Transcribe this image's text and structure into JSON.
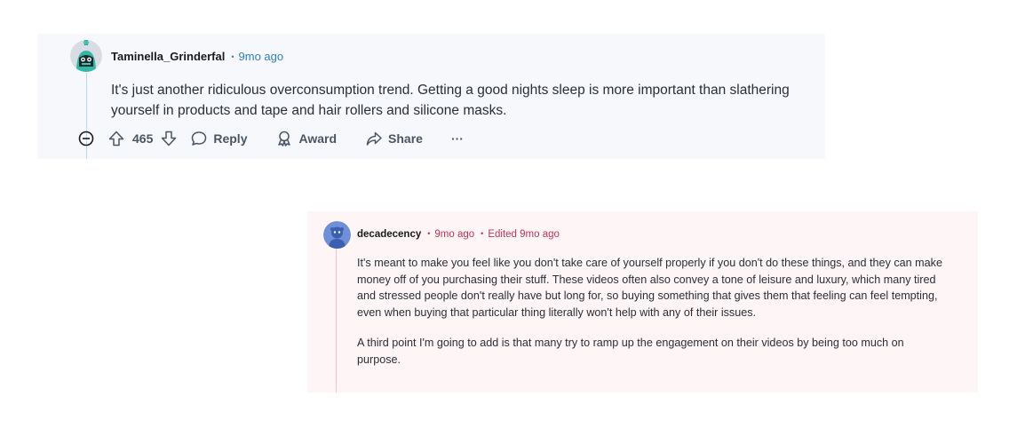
{
  "comment1": {
    "author": "Taminella_Grinderfal",
    "separator": "•",
    "time": "9mo ago",
    "body": "It's just another ridiculous overconsumption trend. Getting a good nights sleep is more important than slathering yourself in products and tape and hair rollers and silicone masks.",
    "votes": "465",
    "actions": {
      "reply": "Reply",
      "award": "Award",
      "share": "Share",
      "more": "···"
    },
    "avatar_icon": "robot-avatar-icon",
    "accent_color": "#2f7fc1",
    "background": "#f6f8fb"
  },
  "comment2": {
    "author": "decadecency",
    "separator": "•",
    "time": "9mo ago",
    "edited": "Edited 9mo ago",
    "paragraphs": [
      "It's meant to make you feel like you don't take care of yourself properly if you don't do these things, and they can make money off of you purchasing their stuff. These videos often also convey a tone of leisure and luxury, which many tired and stressed people don't really have but long for, so buying something that gives them that feeling can feel tempting, even when buying that particular thing literally won't help with any of their issues.",
      "A third point I'm going to add is that many try to ramp up the engagement on their videos by being too much on purpose."
    ],
    "avatar_icon": "default-user-avatar-icon",
    "accent_color": "#c0355a",
    "background": "#fdf5f6"
  }
}
